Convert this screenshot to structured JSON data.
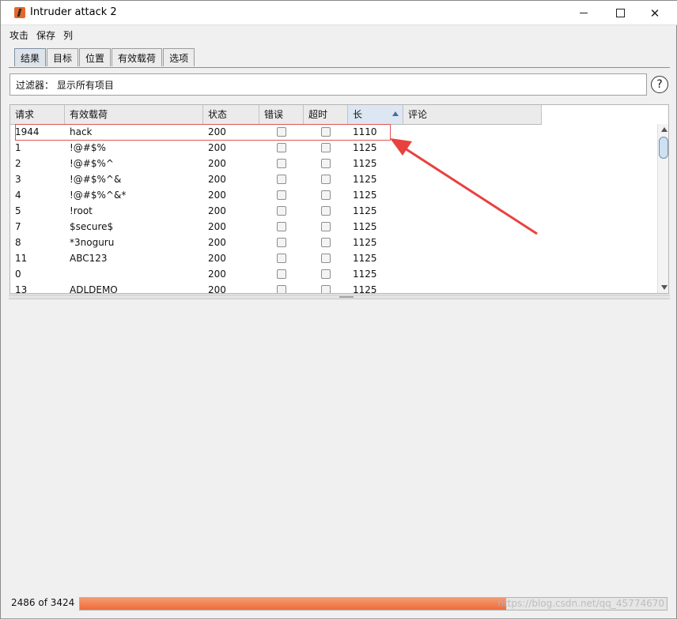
{
  "window": {
    "title": "Intruder attack 2"
  },
  "menu": [
    "攻击",
    "保存",
    "列"
  ],
  "tabs": [
    {
      "label": "结果",
      "active": true
    },
    {
      "label": "目标",
      "active": false
    },
    {
      "label": "位置",
      "active": false
    },
    {
      "label": "有效载荷",
      "active": false
    },
    {
      "label": "选项",
      "active": false
    }
  ],
  "filter": {
    "text": "过滤器： 显示所有项目",
    "help_icon": "?"
  },
  "table": {
    "columns": [
      "请求",
      "有效载荷",
      "状态",
      "错误",
      "超时",
      "长",
      "评论"
    ],
    "sorted_column": "长",
    "rows": [
      {
        "request": "1944",
        "payload": "hack",
        "status": "200",
        "error": false,
        "timeout": false,
        "length": "1110",
        "comment": ""
      },
      {
        "request": "1",
        "payload": "!@#$%",
        "status": "200",
        "error": false,
        "timeout": false,
        "length": "1125",
        "comment": ""
      },
      {
        "request": "2",
        "payload": "!@#$%^",
        "status": "200",
        "error": false,
        "timeout": false,
        "length": "1125",
        "comment": ""
      },
      {
        "request": "3",
        "payload": "!@#$%^&",
        "status": "200",
        "error": false,
        "timeout": false,
        "length": "1125",
        "comment": ""
      },
      {
        "request": "4",
        "payload": "!@#$%^&*",
        "status": "200",
        "error": false,
        "timeout": false,
        "length": "1125",
        "comment": ""
      },
      {
        "request": "5",
        "payload": "!root",
        "status": "200",
        "error": false,
        "timeout": false,
        "length": "1125",
        "comment": ""
      },
      {
        "request": "7",
        "payload": "$secure$",
        "status": "200",
        "error": false,
        "timeout": false,
        "length": "1125",
        "comment": ""
      },
      {
        "request": "8",
        "payload": "*3noguru",
        "status": "200",
        "error": false,
        "timeout": false,
        "length": "1125",
        "comment": ""
      },
      {
        "request": "11",
        "payload": "ABC123",
        "status": "200",
        "error": false,
        "timeout": false,
        "length": "1125",
        "comment": ""
      },
      {
        "request": "0",
        "payload": "",
        "status": "200",
        "error": false,
        "timeout": false,
        "length": "1125",
        "comment": ""
      },
      {
        "request": "13",
        "payload": "ADLDEMO",
        "status": "200",
        "error": false,
        "timeout": false,
        "length": "1125",
        "comment": ""
      }
    ]
  },
  "status": {
    "count_text": "2486 of 3424",
    "progress_fraction": 0.726
  },
  "watermark": "https://blog.csdn.net/qq_45774670",
  "colors": {
    "highlight": "#e15454",
    "progress": "#ef6b3a",
    "arrow": "#e8423f"
  }
}
